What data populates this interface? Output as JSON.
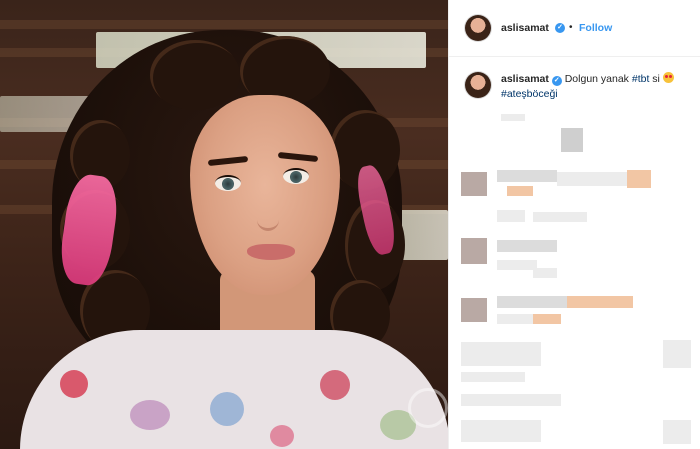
{
  "post": {
    "username": "aslisamat",
    "follow_label": "Follow",
    "dot_separator": "•",
    "verified_glyph": "✓"
  },
  "caption": {
    "username": "aslisamat",
    "text": "Dolgun yanak",
    "hashtag_1": "#tbt",
    "suffix": "si",
    "hashtag_2": "#ateşböceği",
    "emoji_icon": "star-struck-emoji"
  },
  "comments_note": "Comment area is pixelated / blurred in the screenshot",
  "colors": {
    "follow_blue": "#3897f0",
    "hashtag_blue": "#003569",
    "verified_blue": "#3897f0",
    "pink_hair": "#ff6fa8"
  }
}
